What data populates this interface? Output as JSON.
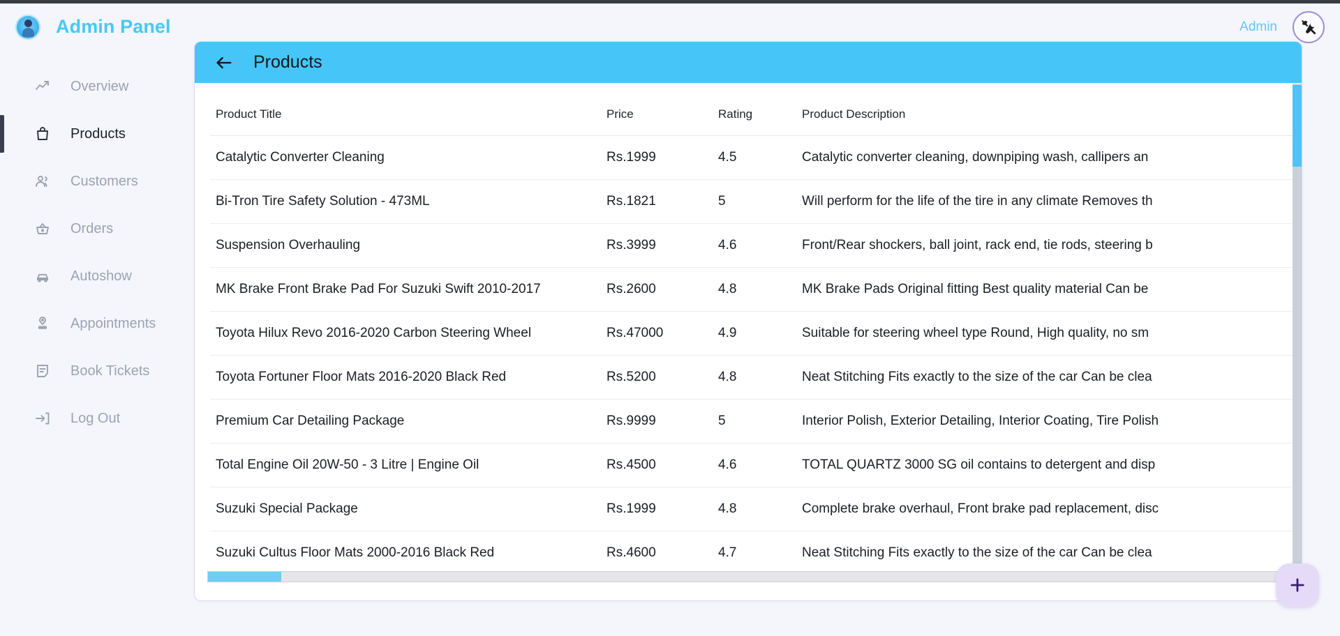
{
  "brand": {
    "title": "Admin Panel",
    "logo_icon": "admin-avatar-badge-icon"
  },
  "topbar": {
    "admin_label": "Admin",
    "tools_icon": "tools-hammer-wrench-icon"
  },
  "sidebar": {
    "items": [
      {
        "label": "Overview",
        "icon": "trending-up-icon",
        "active": false
      },
      {
        "label": "Products",
        "icon": "shopping-bag-icon",
        "active": true
      },
      {
        "label": "Customers",
        "icon": "users-icon",
        "active": false
      },
      {
        "label": "Orders",
        "icon": "basket-icon",
        "active": false
      },
      {
        "label": "Autoshow",
        "icon": "car-icon",
        "active": false
      },
      {
        "label": "Appointments",
        "icon": "person-pin-icon",
        "active": false
      },
      {
        "label": "Book Tickets",
        "icon": "note-list-icon",
        "active": false
      },
      {
        "label": "Log Out",
        "icon": "logout-arrow-icon",
        "active": false
      }
    ]
  },
  "page": {
    "title": "Products",
    "back_icon": "arrow-left-icon",
    "header_color": "#46c6f8"
  },
  "table": {
    "columns": [
      "Product Title",
      "Price",
      "Rating",
      "Product Description"
    ],
    "rows": [
      {
        "title": "Catalytic Converter Cleaning",
        "price": "Rs.1999",
        "rating": "4.5",
        "description": "Catalytic converter cleaning, downpiping wash, callipers an"
      },
      {
        "title": "Bi-Tron Tire Safety Solution - 473ML",
        "price": "Rs.1821",
        "rating": "5",
        "description": "Will perform for the life of the tire in any climate Removes th"
      },
      {
        "title": "Suspension Overhauling",
        "price": "Rs.3999",
        "rating": "4.6",
        "description": "Front/Rear shockers, ball joint, rack end, tie rods, steering b"
      },
      {
        "title": "MK Brake Front Brake Pad For Suzuki Swift 2010-2017",
        "price": "Rs.2600",
        "rating": "4.8",
        "description": "MK Brake Pads Original fitting Best quality material Can be"
      },
      {
        "title": "Toyota Hilux Revo 2016-2020 Carbon Steering Wheel",
        "price": "Rs.47000",
        "rating": "4.9",
        "description": "Suitable for steering wheel type Round, High quality, no sm"
      },
      {
        "title": "Toyota Fortuner Floor Mats 2016-2020 Black Red",
        "price": "Rs.5200",
        "rating": "4.8",
        "description": "Neat Stitching Fits exactly to the size of the car Can be clea"
      },
      {
        "title": "Premium Car Detailing Package",
        "price": "Rs.9999",
        "rating": "5",
        "description": "Interior Polish, Exterior Detailing, Interior Coating, Tire Polish"
      },
      {
        "title": "Total Engine Oil 20W-50 - 3 Litre | Engine Oil",
        "price": "Rs.4500",
        "rating": "4.6",
        "description": "TOTAL QUARTZ 3000 SG oil contains to detergent and disp"
      },
      {
        "title": "Suzuki Special Package",
        "price": "Rs.1999",
        "rating": "4.8",
        "description": "Complete brake overhaul, Front brake pad replacement, disc"
      },
      {
        "title": "Suzuki Cultus Floor Mats 2000-2016 Black Red",
        "price": "Rs.4600",
        "rating": "4.7",
        "description": "Neat Stitching Fits exactly to the size of the car Can be clea"
      }
    ]
  },
  "fab": {
    "icon": "plus-icon",
    "label": "+"
  },
  "colors": {
    "accent_blue": "#46c6f8",
    "brand_blue": "#49c8f5",
    "fab_purple": "#e6daf9",
    "sidebar_bg": "#f4f6fb"
  }
}
